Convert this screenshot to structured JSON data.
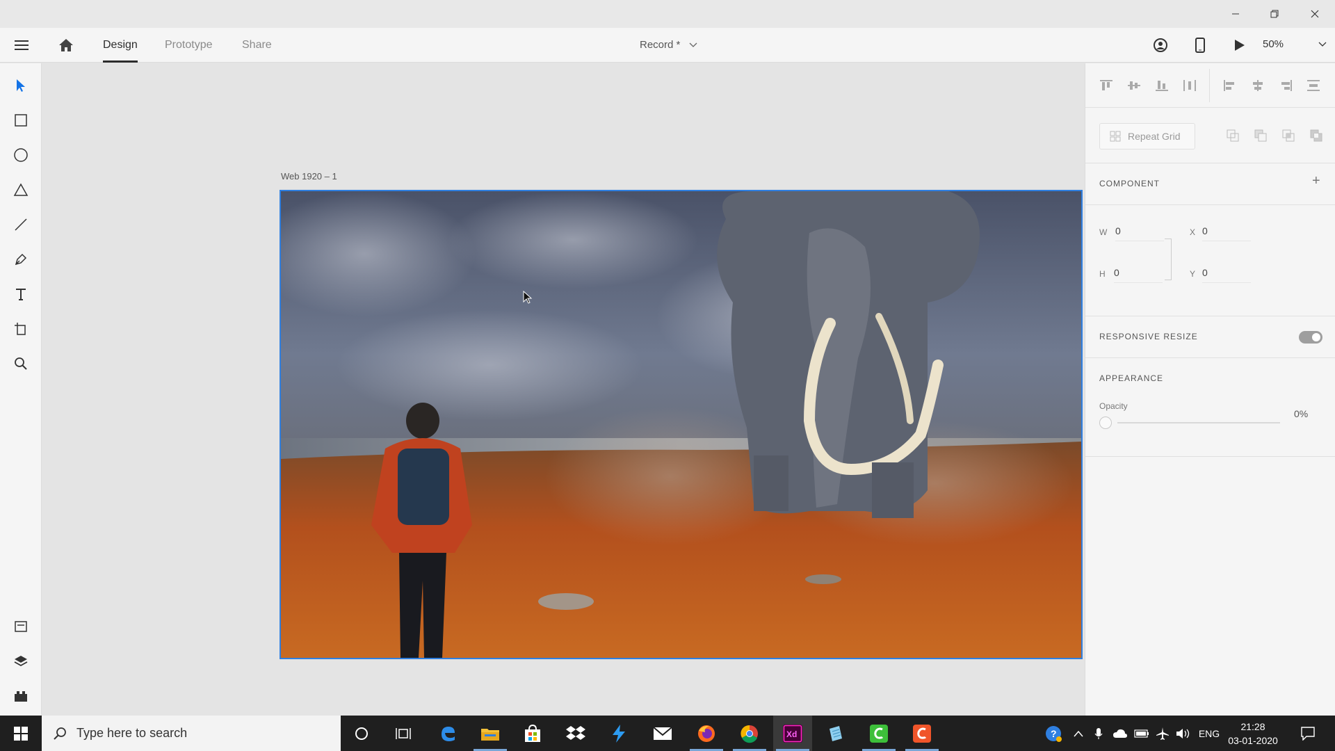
{
  "header": {
    "tabs": [
      {
        "label": "Design"
      },
      {
        "label": "Prototype"
      },
      {
        "label": "Share"
      }
    ],
    "document_title": "Record *",
    "zoom": "50%"
  },
  "toolbar": {
    "tools": [
      "select-icon",
      "rectangle-icon",
      "ellipse-icon",
      "polygon-icon",
      "line-icon",
      "pen-icon",
      "text-icon",
      "artboard-icon",
      "zoom-icon"
    ],
    "bottom": [
      "assets-icon",
      "layers-icon",
      "plugins-icon"
    ]
  },
  "canvas": {
    "artboard_label": "Web 1920 – 1"
  },
  "panel": {
    "repeat_grid": "Repeat Grid",
    "component_title": "COMPONENT",
    "component_add": "+",
    "w_label": "W",
    "w_value": "0",
    "h_label": "H",
    "h_value": "0",
    "x_label": "X",
    "x_value": "0",
    "y_label": "Y",
    "y_value": "0",
    "responsive_title": "RESPONSIVE RESIZE",
    "responsive_on": true,
    "appearance_title": "APPEARANCE",
    "opacity_label": "Opacity",
    "opacity_value": "0%"
  },
  "taskbar": {
    "search_placeholder": "Type here to search",
    "apps": [
      "cortana",
      "task-view",
      "edge",
      "file-explorer",
      "store",
      "dropbox",
      "vscode",
      "mail",
      "firefox",
      "chrome",
      "adobe-xd",
      "notepad",
      "camtasia",
      "camtasia-recorder"
    ],
    "language": "ENG",
    "time": "21:28",
    "date": "03-01-2020"
  },
  "colors": {
    "accent": "#2f7fe0",
    "xd_pink": "#ff2bc2",
    "taskbar": "#1f1f1f"
  }
}
